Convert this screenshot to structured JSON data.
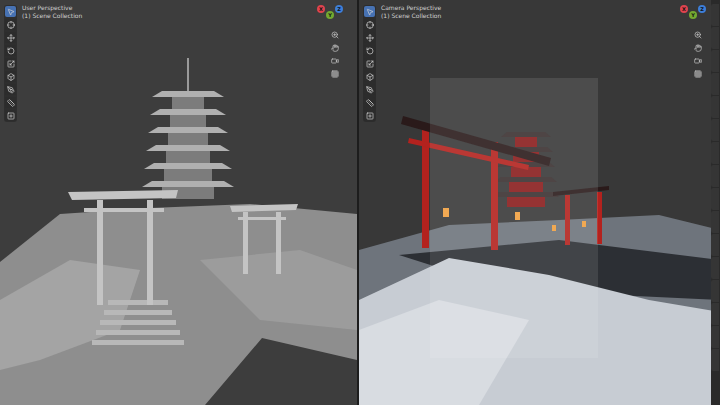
{
  "viewports": [
    {
      "title": "User Perspective",
      "subtitle": "(1) Scene Collection",
      "kind": "solid",
      "tools": [
        {
          "selected": true
        },
        {
          "selected": false
        },
        {
          "selected": false
        },
        {
          "selected": false
        },
        {
          "selected": false
        },
        {
          "selected": false
        },
        {
          "selected": false
        },
        {
          "selected": false
        },
        {
          "selected": false
        }
      ],
      "gizmo": [
        {
          "label": "X",
          "color": "#e0434e"
        },
        {
          "label": "Y",
          "color": "#74a830"
        },
        {
          "label": "Z",
          "color": "#3d7ed8"
        }
      ]
    },
    {
      "title": "Camera Perspective",
      "subtitle": "(1) Scene Collection",
      "kind": "rendered",
      "tools": [
        {
          "selected": true
        },
        {
          "selected": false
        },
        {
          "selected": false
        },
        {
          "selected": false
        },
        {
          "selected": false
        },
        {
          "selected": false
        },
        {
          "selected": false
        },
        {
          "selected": false
        },
        {
          "selected": false
        }
      ],
      "gizmo": [
        {
          "label": "X",
          "color": "#e0434e"
        },
        {
          "label": "Y",
          "color": "#74a830"
        },
        {
          "label": "Z",
          "color": "#3d7ed8"
        }
      ]
    }
  ]
}
